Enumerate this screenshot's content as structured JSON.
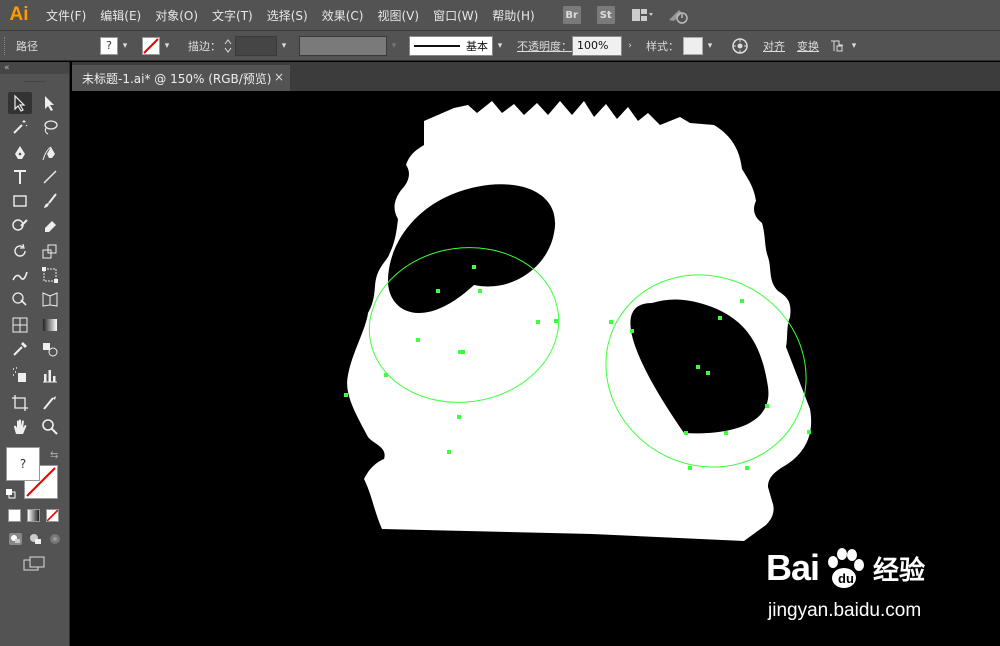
{
  "app": {
    "logo_text": "Ai"
  },
  "menu": [
    {
      "id": "file",
      "label": "文件(F)"
    },
    {
      "id": "edit",
      "label": "编辑(E)"
    },
    {
      "id": "object",
      "label": "对象(O)"
    },
    {
      "id": "type",
      "label": "文字(T)"
    },
    {
      "id": "select",
      "label": "选择(S)"
    },
    {
      "id": "effect",
      "label": "效果(C)"
    },
    {
      "id": "view",
      "label": "视图(V)"
    },
    {
      "id": "window",
      "label": "窗口(W)"
    },
    {
      "id": "help",
      "label": "帮助(H)"
    }
  ],
  "menu_badges": {
    "bridge": "Br",
    "stock": "St"
  },
  "control": {
    "selection_type": "路径",
    "fill_value": "?",
    "stroke_label": "描边：",
    "brush_label": "基本",
    "opacity_label": "不透明度：",
    "opacity_value": "100%",
    "style_label": "样式：",
    "align_label": "对齐",
    "transform_label": "变换"
  },
  "tab": {
    "title": "未标题-1.ai* @ 150% (RGB/预览)",
    "close": "×"
  },
  "tools": {
    "fill_value": "?"
  },
  "colors": {
    "ui_bg": "#535353",
    "canvas_bg": "#000000",
    "path_selection": "#3dff3d",
    "accent_logo": "#ff9a00"
  },
  "watermark": {
    "brand_bai": "Bai",
    "brand_du": "du",
    "brand_jy": "经验",
    "url": "jingyan.baidu.com"
  }
}
